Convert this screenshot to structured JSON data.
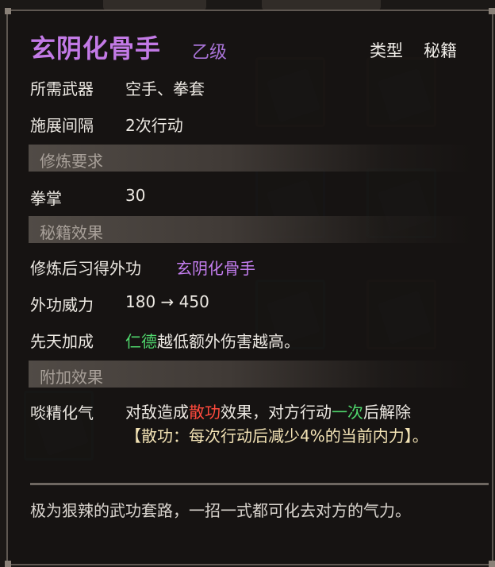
{
  "skill": {
    "name": "玄阴化骨手",
    "grade": "乙级",
    "type_label": "类型",
    "type_value": "秘籍"
  },
  "stats": {
    "weapon_label": "所需武器",
    "weapon_value": "空手、拳套",
    "interval_label": "施展间隔",
    "interval_value": "2次行动"
  },
  "requirements": {
    "header": "修炼要求",
    "skill_label": "拳掌",
    "skill_value": "30"
  },
  "effects": {
    "header": "秘籍效果",
    "learn_label": "修炼后习得外功",
    "learn_value": "玄阴化骨手",
    "power_label": "外功威力",
    "power_value": "180 → 450",
    "innate_label": "先天加成",
    "innate_attr": "仁德",
    "innate_text": "越低额外伤害越高。"
  },
  "extra": {
    "header": "附加效果",
    "name": "啖精化气",
    "text_1": "对敌造成",
    "keyword": "散功",
    "text_2": "效果，对方行动",
    "keyword_2": "一次",
    "text_3": "后解除",
    "detail": "【散功：每次行动后减少4%的当前内力】。"
  },
  "description": "极为狠辣的武功套路，一招一式都可化去对方的气力。",
  "colors": {
    "title": "#c37ae6",
    "attribute_green": "#4fd66c",
    "keyword_red": "#ff4a3d",
    "detail_cream": "#f3e3b5"
  }
}
